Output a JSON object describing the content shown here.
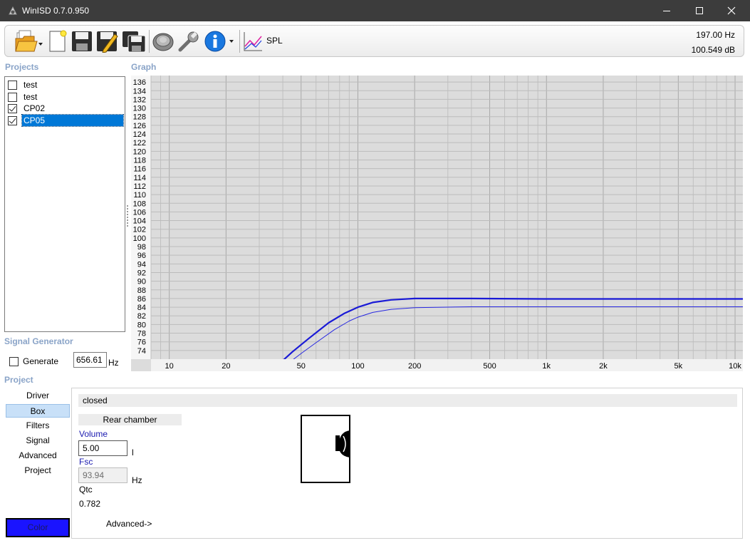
{
  "window": {
    "title": "WinISD 0.7.0.950",
    "controls": {
      "minimize": "minimize-icon",
      "maximize": "maximize-icon",
      "close": "close-icon"
    }
  },
  "toolbar": {
    "open_icon": "folder-open-icon",
    "new_icon": "new-document-icon",
    "save_icon": "floppy-disk-icon",
    "save_as_icon": "floppy-pencil-icon",
    "save_all_icon": "floppy-multiple-icon",
    "driver_icon": "speaker-icon",
    "settings_icon": "wrench-icon",
    "info_icon": "info-icon",
    "graph_icon": "graph-icon",
    "graph_type": "SPL",
    "readout_freq": "197.00 Hz",
    "readout_level": "100.549 dB"
  },
  "projects": {
    "label": "Projects",
    "items": [
      {
        "label": "test",
        "checked": false,
        "selected": false
      },
      {
        "label": "test",
        "checked": false,
        "selected": false
      },
      {
        "label": "CP02",
        "checked": true,
        "selected": false
      },
      {
        "label": "CP05",
        "checked": true,
        "selected": true
      }
    ]
  },
  "graph": {
    "label": "Graph"
  },
  "chart_data": {
    "type": "line",
    "xscale": "log",
    "xlim": [
      8,
      11000
    ],
    "ylim": [
      72,
      137.5
    ],
    "x_ticks": [
      10,
      20,
      50,
      100,
      200,
      500,
      1000,
      2000,
      5000,
      10000
    ],
    "x_tick_labels": [
      "10",
      "20",
      "50",
      "100",
      "200",
      "500",
      "1k",
      "2k",
      "5k",
      "10k"
    ],
    "y_ticks": [
      74,
      76,
      78,
      80,
      82,
      84,
      86,
      88,
      90,
      92,
      94,
      96,
      98,
      100,
      102,
      104,
      106,
      108,
      110,
      112,
      114,
      116,
      118,
      120,
      122,
      124,
      126,
      128,
      130,
      132,
      134,
      136
    ],
    "grid": true,
    "series": [
      {
        "color": "#1a1ad6",
        "width": 2.2,
        "x": [
          38,
          45,
          55,
          70,
          85,
          100,
          120,
          150,
          200,
          400,
          1000,
          11000
        ],
        "y": [
          70.8,
          73.7,
          76.8,
          80.4,
          82.6,
          84.0,
          85.1,
          85.7,
          86.0,
          86.0,
          85.9,
          85.9
        ]
      },
      {
        "color": "#2828e0",
        "width": 1,
        "x": [
          42,
          50,
          60,
          75,
          90,
          100,
          120,
          150,
          200,
          400,
          1000,
          11000
        ],
        "y": [
          70.8,
          73.3,
          75.8,
          78.8,
          80.8,
          81.7,
          82.8,
          83.5,
          83.9,
          84.1,
          84.1,
          84.1
        ]
      }
    ]
  },
  "signal_generator": {
    "label": "Signal Generator",
    "generate_label": "Generate",
    "generate_checked": false,
    "frequency": "656.61",
    "unit": "Hz"
  },
  "project_nav": {
    "label": "Project",
    "items": [
      "Driver",
      "Box",
      "Filters",
      "Signal",
      "Advanced",
      "Project"
    ],
    "active": "Box",
    "color_button": "Color",
    "color_value": "#1a14ff"
  },
  "box_panel": {
    "type": "closed",
    "chamber_header": "Rear chamber",
    "volume_label": "Volume",
    "volume_value": "5.00",
    "volume_unit": "l",
    "fsc_label": "Fsc",
    "fsc_value": "93.94",
    "fsc_unit": "Hz",
    "qtc_label": "Qtc",
    "qtc_value": "0.782",
    "advanced_link": "Advanced->",
    "diagram_icon": "closed-box-driver-icon"
  }
}
